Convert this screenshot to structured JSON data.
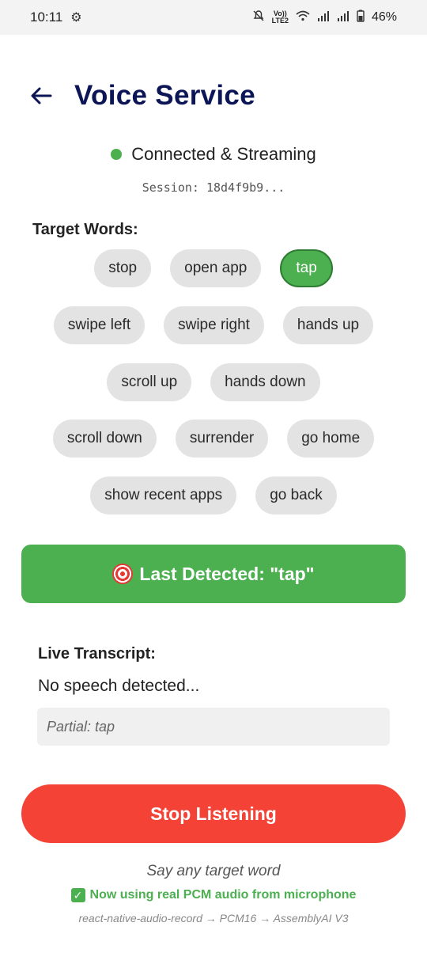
{
  "statusbar": {
    "time": "10:11",
    "settings_icon": "gear-icon",
    "network_label_top": "Vo))",
    "network_label_bottom": "LTE2",
    "battery": "46%"
  },
  "header": {
    "back_icon": "arrow-left-icon",
    "title": "Voice Service"
  },
  "connection": {
    "status": "Connected & Streaming",
    "status_color": "#4caf50",
    "session": "Session: 18d4f9b9..."
  },
  "targets": {
    "label": "Target Words:",
    "rows": [
      [
        {
          "word": "stop",
          "active": false
        },
        {
          "word": "open app",
          "active": false
        },
        {
          "word": "tap",
          "active": true
        }
      ],
      [
        {
          "word": "swipe left",
          "active": false
        },
        {
          "word": "swipe right",
          "active": false
        },
        {
          "word": "hands up",
          "active": false
        }
      ],
      [
        {
          "word": "scroll up",
          "active": false
        },
        {
          "word": "hands down",
          "active": false
        }
      ],
      [
        {
          "word": "scroll down",
          "active": false
        },
        {
          "word": "surrender",
          "active": false
        },
        {
          "word": "go home",
          "active": false
        }
      ],
      [
        {
          "word": "show recent apps",
          "active": false
        },
        {
          "word": "go back",
          "active": false
        }
      ]
    ]
  },
  "detected": {
    "icon": "target-icon",
    "text": "Last Detected: \"tap\"",
    "color": "#4caf50"
  },
  "transcript": {
    "label": "Live Transcript:",
    "text": "No speech detected...",
    "partial": "Partial: tap"
  },
  "actions": {
    "stop_label": "Stop Listening",
    "stop_color": "#f44336"
  },
  "footer": {
    "hint": "Say any target word",
    "pcm_note": "Now using real PCM audio from microphone",
    "pipeline": "react-native-audio-record → PCM16 → AssemblyAI V3"
  }
}
